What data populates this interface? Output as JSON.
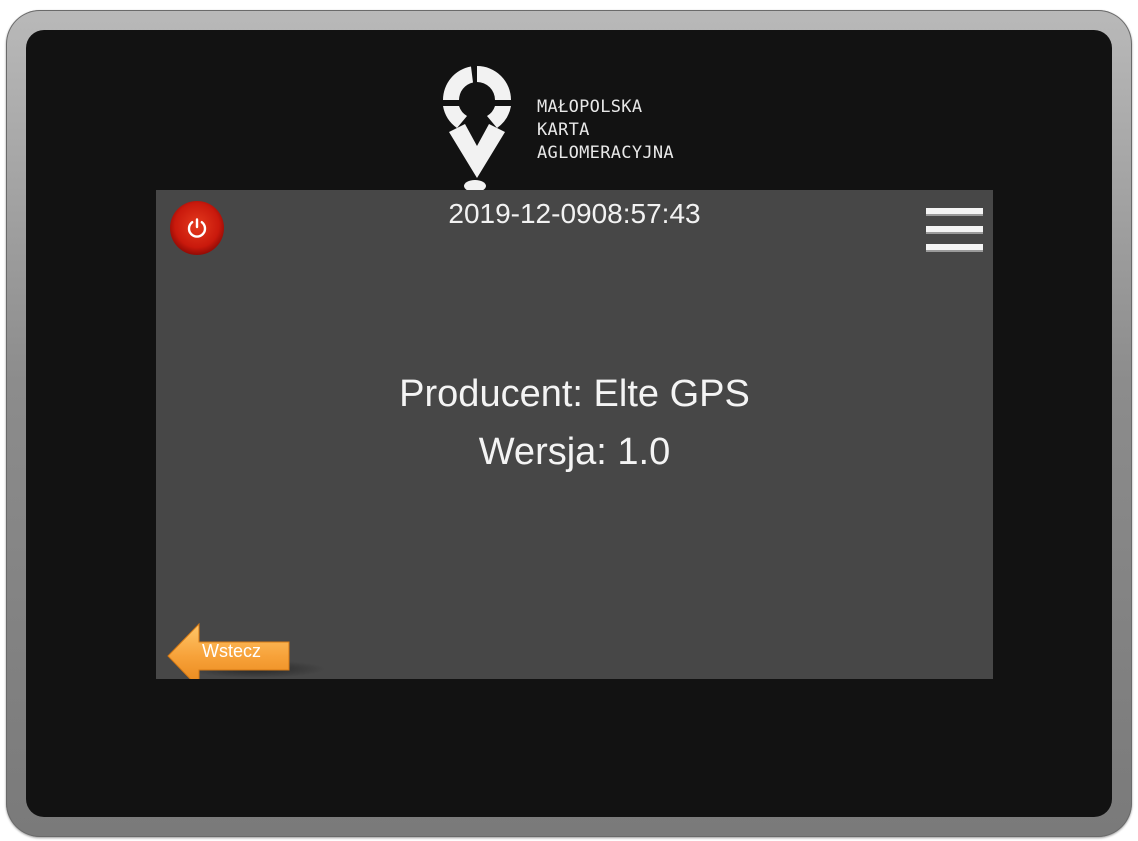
{
  "logo": {
    "line1": "MAŁOPOLSKA",
    "line2": "KARTA",
    "line3": "AGLOMERACYJNA",
    "icon": "map-pin-logo-icon"
  },
  "header": {
    "date": "2019-12-09",
    "time": "08:57:43"
  },
  "icons": {
    "power": "power-icon",
    "menu": "hamburger-menu-icon",
    "back": "arrow-left-icon"
  },
  "info": {
    "producent_label": "Producent:",
    "producent_value": "Elte GPS",
    "wersja_label": "Wersja:",
    "wersja_value": "1.0"
  },
  "back_button": {
    "label": "Wstecz"
  },
  "colors": {
    "screen_background": "#474747",
    "bezel": "#121212",
    "power_red": "#c9190c",
    "back_orange": "#f7a23a"
  }
}
